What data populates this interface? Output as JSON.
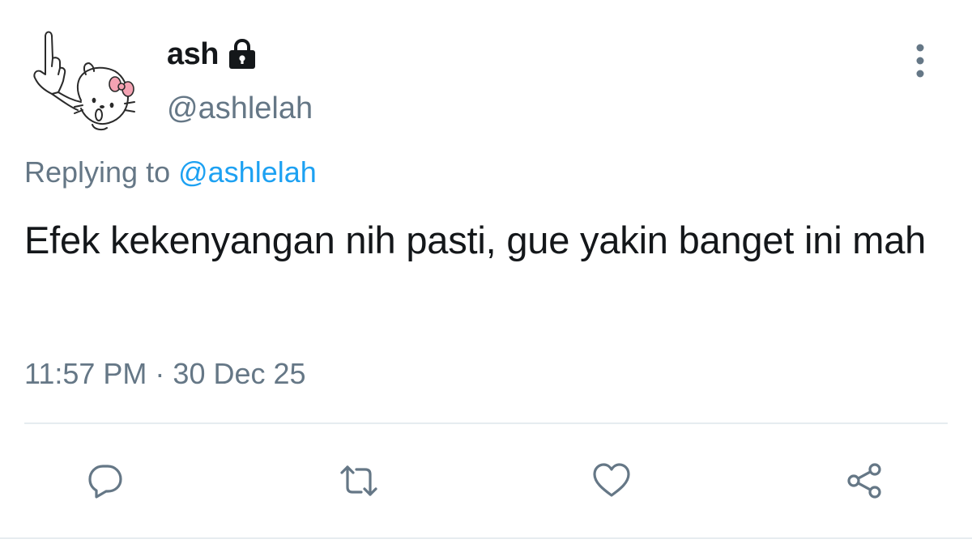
{
  "user": {
    "display_name": "ash",
    "handle": "@ashlelah",
    "protected": true,
    "avatar_description": "hello-kitty-drawing"
  },
  "reply": {
    "prefix": "Replying to ",
    "mention": "@ashlelah"
  },
  "tweet": {
    "text": "Efek kekenyangan nih pasti, gue yakin banget ini mah",
    "time": "11:57 PM",
    "separator": " · ",
    "date": "30 Dec 25"
  },
  "icons": {
    "lock": "lock-icon",
    "more": "vertical-ellipsis-icon",
    "reply": "speech-bubble-icon",
    "retweet": "retweet-arrows-icon",
    "like": "heart-icon",
    "share": "share-nodes-icon"
  },
  "colors": {
    "text": "#14171a",
    "secondary": "#657786",
    "link": "#1da1f2",
    "divider": "#e6ecf0"
  }
}
